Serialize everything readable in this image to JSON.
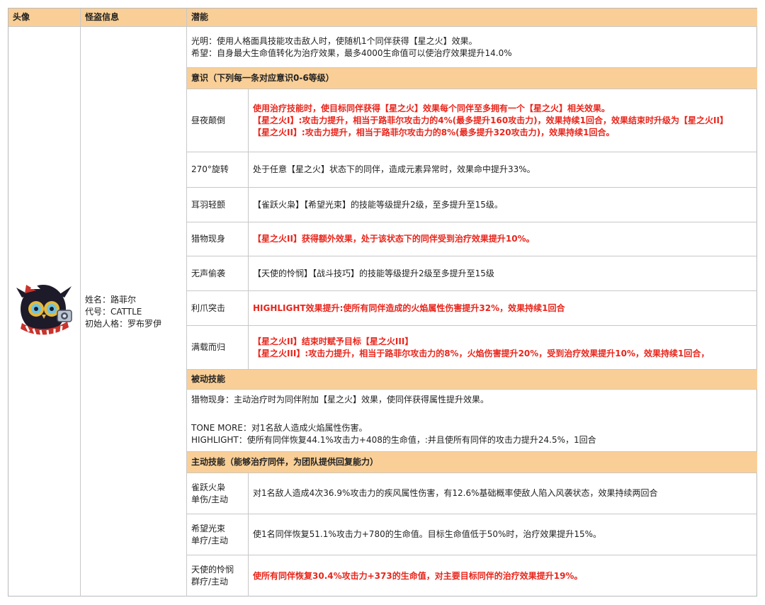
{
  "header": {
    "col_avatar": "头像",
    "col_info": "怪盗信息",
    "col_potential": "潜能"
  },
  "thief": {
    "name": "姓名：路菲尔",
    "code": "代号：CATTLE",
    "persona": "初始人格：罗布罗伊",
    "avatar_icon": "owl-masked-character-icon"
  },
  "potential": {
    "line1": "光明：使用人格面具技能攻击敌人时，使随机1个同伴获得【星之火】效果。",
    "line2": "希望：自身最大生命值转化为治疗效果，最多4000生命值可以使治疗效果提升14.0%"
  },
  "awareness": {
    "title": "意识（下列每一条对应意识0-6等级）",
    "rows": [
      {
        "name": "昼夜颠倒",
        "lines": [
          "使用治疗技能时，使目标同伴获得【星之火】效果每个同伴至多拥有一个【星之火】相关效果。",
          "【星之火I】:攻击力提升，相当于路菲尔攻击力的4%(最多提升160攻击力)，效果持续1回合，效果结束时升级为【星之火II】",
          "【星之火II】:攻击力提升，相当于路菲尔攻击力的8%(最多提升320攻击力)，效果持续1回合。"
        ]
      },
      {
        "name": "270°旋转",
        "lines": [
          "处于任意【星之火】状态下的同伴，造成元素异常时，效果命中提升33%。"
        ]
      },
      {
        "name": "耳羽轻颤",
        "lines": [
          "【雀跃火枭】【希望光束】的技能等级提升2级，至多提升至15级。"
        ]
      },
      {
        "name": "猎物现身",
        "lines": [
          "【星之火II】获得额外效果，处于该状态下的同伴受到治疗效果提升10%。"
        ]
      },
      {
        "name": "无声偷袭",
        "lines": [
          "【天使的怜悯】【战斗技巧】的技能等级提升2级至多提升至15级"
        ]
      },
      {
        "name": "利爪突击",
        "lines": [
          "HIGHLIGHT效果提升:使所有同伴造成的火焰属性伤害提升32%，效果持续1回合"
        ]
      },
      {
        "name": "满载而归",
        "lines": [
          "【星之火II】结束时赋予目标【星之火III】",
          "【星之火III】:攻击力提升，相当于路菲尔攻击力的8%，火焰伤害提升20%，受到治疗效果提升10%，效果持续1回合，"
        ]
      }
    ]
  },
  "passive": {
    "title": "被动技能",
    "line1": "猎物现身：主动治疗时为同伴附加【星之火】效果，使同伴获得属性提升效果。",
    "line2": "TONE MORE：对1名敌人造成火焰属性伤害。",
    "line3": "HIGHLIGHT：使所有同伴恢复44.1%攻击力+408的生命值，:并且使所有同伴的攻击力提升24.5%，1回合"
  },
  "active": {
    "title": "主动技能（能够治疗同伴，为团队提供回复能力）",
    "rows": [
      {
        "name": "雀跃火枭",
        "type": "单伤/主动",
        "desc": "对1名敌人造成4次36.9%攻击力的疾风属性伤害，有12.6%基础概率使敌人陷入风袭状态，效果持续两回合"
      },
      {
        "name": "希望光束",
        "type": "单疗/主动",
        "desc": "使1名同伴恢复51.1%攻击力+780的生命值。目标生命值低于50%时，治疗效果提升15%。"
      },
      {
        "name": "天使的怜悯",
        "type": "群疗/主动",
        "desc": "使所有同伴恢复30.4%攻击力+373的生命值，对主要目标同伴的治疗效果提升19%。"
      }
    ]
  },
  "colors": {
    "header_bg": "#f9cf97",
    "highlight_red": "#e8261c",
    "border": "#c8c8c8"
  }
}
